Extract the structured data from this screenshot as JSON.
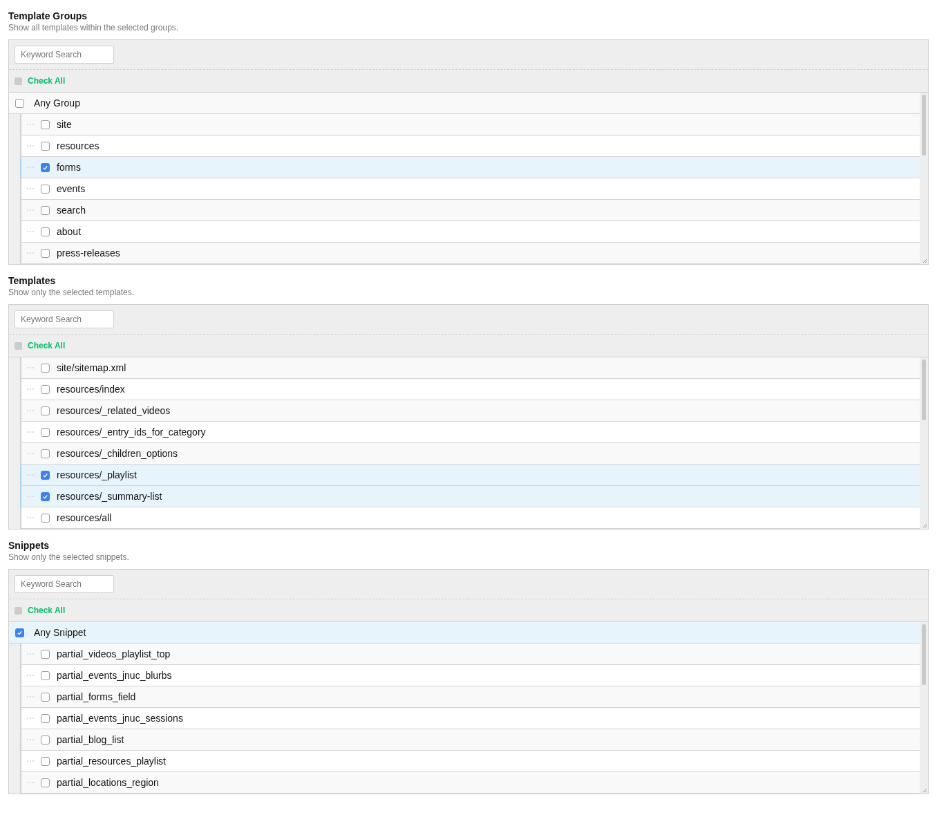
{
  "sections": [
    {
      "title": "Template Groups",
      "description": "Show all templates within the selected groups.",
      "search": {
        "placeholder": "Keyword Search"
      },
      "check_all": {
        "label": "Check All",
        "checked": false
      },
      "any": {
        "label": "Any Group",
        "checked": false
      },
      "items": [
        {
          "label": "site",
          "checked": false
        },
        {
          "label": "resources",
          "checked": false
        },
        {
          "label": "forms",
          "checked": true
        },
        {
          "label": "events",
          "checked": false
        },
        {
          "label": "search",
          "checked": false
        },
        {
          "label": "about",
          "checked": false
        },
        {
          "label": "press-releases",
          "checked": false
        }
      ]
    },
    {
      "title": "Templates",
      "description": "Show only the selected templates.",
      "search": {
        "placeholder": "Keyword Search"
      },
      "check_all": {
        "label": "Check All",
        "checked": false
      },
      "items": [
        {
          "label": "site/sitemap.xml",
          "checked": false
        },
        {
          "label": "resources/index",
          "checked": false
        },
        {
          "label": "resources/_related_videos",
          "checked": false
        },
        {
          "label": "resources/_entry_ids_for_category",
          "checked": false
        },
        {
          "label": "resources/_children_options",
          "checked": false
        },
        {
          "label": "resources/_playlist",
          "checked": true
        },
        {
          "label": "resources/_summary-list",
          "checked": true
        },
        {
          "label": "resources/all",
          "checked": false
        }
      ]
    },
    {
      "title": "Snippets",
      "description": "Show only the selected snippets.",
      "search": {
        "placeholder": "Keyword Search"
      },
      "check_all": {
        "label": "Check All",
        "checked": false
      },
      "any": {
        "label": "Any Snippet",
        "checked": true
      },
      "items": [
        {
          "label": "partial_videos_playlist_top",
          "checked": false
        },
        {
          "label": "partial_events_jnuc_blurbs",
          "checked": false
        },
        {
          "label": "partial_forms_field",
          "checked": false
        },
        {
          "label": "partial_events_jnuc_sessions",
          "checked": false
        },
        {
          "label": "partial_blog_list",
          "checked": false
        },
        {
          "label": "partial_resources_playlist",
          "checked": false
        },
        {
          "label": "partial_locations_region",
          "checked": false
        }
      ]
    }
  ]
}
